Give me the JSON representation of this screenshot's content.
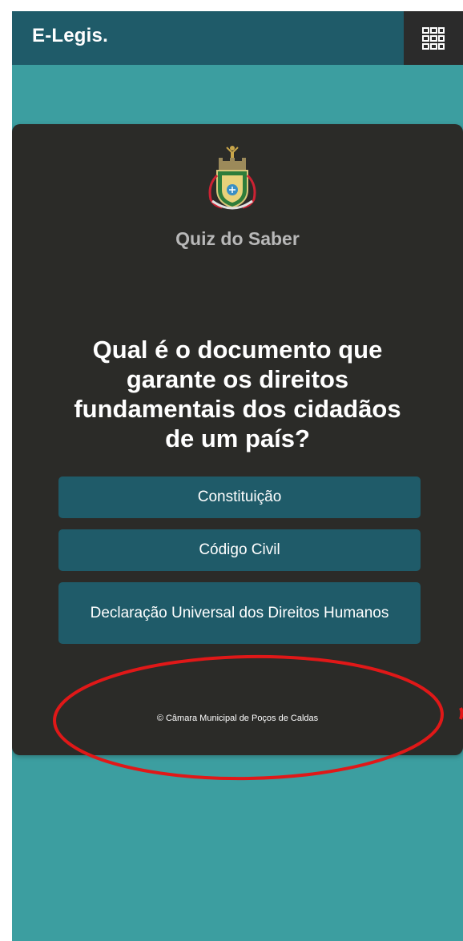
{
  "header": {
    "brand": "E-Legis.",
    "apps_icon": "grid-icon"
  },
  "quiz": {
    "emblem_icon": "coat-of-arms-icon",
    "title": "Quiz do Saber",
    "question": "Qual é o documento que garante os direitos fundamentais dos cidadãos de um país?",
    "options": [
      {
        "label": "Constituição"
      },
      {
        "label": "Código Civil"
      },
      {
        "label": "Declaração Universal dos Direitos Humanos"
      }
    ],
    "footer": "© Câmara Municipal de Poços de Caldas"
  },
  "colors": {
    "header_bg": "#1f5b69",
    "page_bg": "#3c9ea0",
    "card_bg": "#2b2b28",
    "button_bg": "#1f5b69",
    "annotation": "#e01818"
  }
}
